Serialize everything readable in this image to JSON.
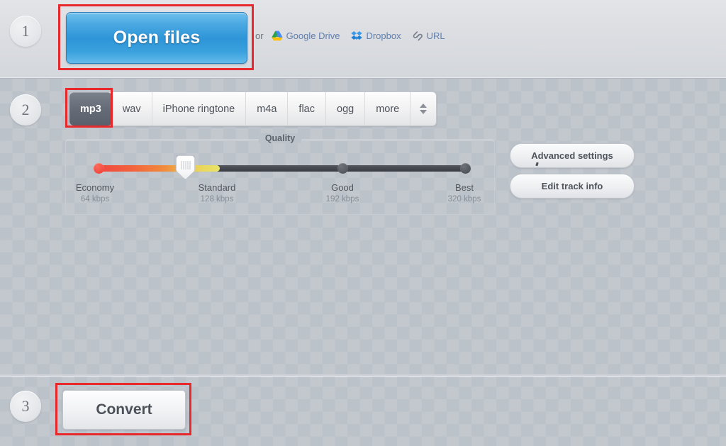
{
  "steps": {
    "one": "1",
    "two": "2",
    "three": "3"
  },
  "open": {
    "button_label": "Open files",
    "or_label": "or",
    "sources": [
      {
        "label": "Google Drive",
        "icon": "google-drive-icon"
      },
      {
        "label": "Dropbox",
        "icon": "dropbox-icon"
      },
      {
        "label": "URL",
        "icon": "link-icon"
      }
    ]
  },
  "formats": {
    "tabs": [
      {
        "label": "mp3",
        "active": true
      },
      {
        "label": "wav",
        "active": false
      },
      {
        "label": "iPhone ringtone",
        "active": false
      },
      {
        "label": "m4a",
        "active": false
      },
      {
        "label": "flac",
        "active": false
      },
      {
        "label": "ogg",
        "active": false
      },
      {
        "label": "more",
        "active": false
      }
    ],
    "stepper_icon": "up-down-stepper-icon"
  },
  "quality": {
    "legend": "Quality",
    "selected": "Standard",
    "stops": [
      {
        "name": "Economy",
        "rate": "64 kbps"
      },
      {
        "name": "Standard",
        "rate": "128 kbps"
      },
      {
        "name": "Good",
        "rate": "192 kbps"
      },
      {
        "name": "Best",
        "rate": "320 kbps"
      }
    ]
  },
  "side_buttons": {
    "advanced": "Advanced settings",
    "edit_track": "Edit track info"
  },
  "convert": {
    "button_label": "Convert"
  },
  "colors": {
    "accent_blue": "#2e95d8",
    "annotation_red": "#e8282b",
    "active_tab": "#666c77",
    "background": "#bcc2ca",
    "quality_low": "#f0453f",
    "quality_high": "#3c4046"
  }
}
